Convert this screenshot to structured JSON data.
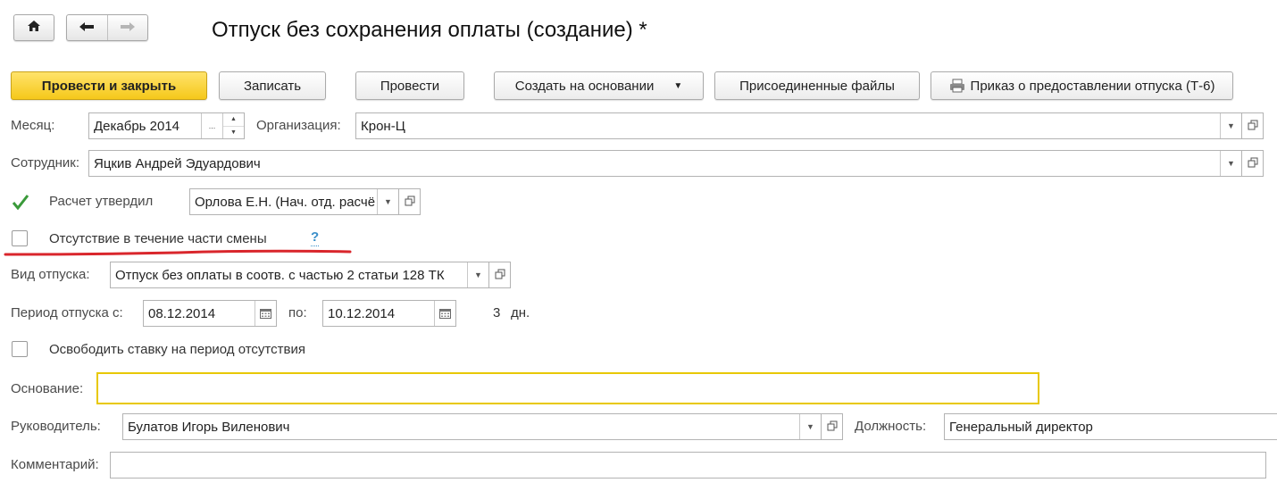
{
  "window": {
    "title": "Отпуск без сохранения оплаты (создание) *"
  },
  "toolbar": {
    "post_close": "Провести и закрыть",
    "save": "Записать",
    "post": "Провести",
    "create_based": "Создать на основании",
    "attached_files": "Присоединенные файлы",
    "print_order": "Приказ о предоставлении отпуска (Т-6)"
  },
  "form": {
    "month": {
      "label": "Месяц:",
      "value": "Декабрь 2014",
      "choose": "..."
    },
    "organization": {
      "label": "Организация:",
      "value": "Крон-Ц"
    },
    "employee": {
      "label": "Сотрудник:",
      "value": "Яцкив Андрей Эдуардович"
    },
    "calc_approved": {
      "label": "Расчет утвердил",
      "checked": true,
      "value": "Орлова Е.Н. (Нач. отд. расчё"
    },
    "partial_absence": {
      "label": "Отсутствие в течение части смены",
      "checked": false,
      "help": "?"
    },
    "leave_type": {
      "label": "Вид отпуска:",
      "value": "Отпуск без оплаты в соотв. с частью 2 статьи 128 ТК"
    },
    "period": {
      "label_from": "Период отпуска с:",
      "from": "08.12.2014",
      "label_to": "по:",
      "to": "10.12.2014",
      "days": "3",
      "days_unit": "дн."
    },
    "release_rate": {
      "label": "Освободить ставку на период отсутствия",
      "checked": false
    },
    "basis": {
      "label": "Основание:",
      "value": ""
    },
    "manager": {
      "label": "Руководитель:",
      "value": "Булатов Игорь Виленович"
    },
    "position": {
      "label": "Должность:",
      "value": "Генеральный директор"
    },
    "comment": {
      "label": "Комментарий:",
      "value": ""
    }
  },
  "colors": {
    "primary_button": "#f5c81a",
    "annotation_line": "#d9262c",
    "help_link": "#3a8fc9",
    "checkmark": "#3a9a3a",
    "focused_border": "#e8c800"
  }
}
